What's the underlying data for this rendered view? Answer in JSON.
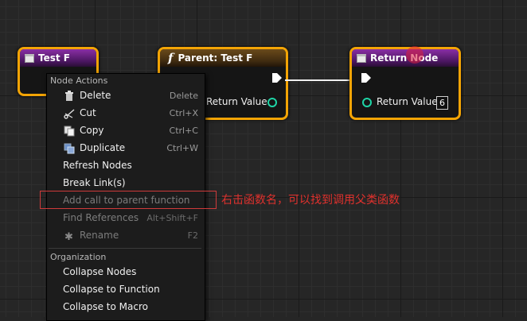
{
  "nodes": {
    "test_f": {
      "title": "Test F",
      "icon": "function-entry-icon"
    },
    "parent": {
      "title": "Parent: Test F",
      "icon": "function-f-icon",
      "pin_label": "Return Value"
    },
    "return": {
      "title": "Return Node",
      "icon": "function-return-icon",
      "pin_label": "Return Value",
      "value": "6"
    }
  },
  "colors": {
    "node_border": "#f3a405",
    "data_pin": "#1ed5a6",
    "annotation": "#e0312d",
    "highlight": "#cf3a3a"
  },
  "menu": {
    "node_actions_title": "Node Actions",
    "items": [
      {
        "label": "Delete",
        "shortcut": "Delete",
        "icon": "trash-icon",
        "enabled": true
      },
      {
        "label": "Cut",
        "shortcut": "Ctrl+X",
        "icon": "scissors-icon",
        "enabled": true
      },
      {
        "label": "Copy",
        "shortcut": "Ctrl+C",
        "icon": "copy-icon",
        "enabled": true
      },
      {
        "label": "Duplicate",
        "shortcut": "Ctrl+W",
        "icon": "duplicate-icon",
        "enabled": true
      },
      {
        "label": "Refresh Nodes",
        "shortcut": "",
        "enabled": true
      },
      {
        "label": "Break Link(s)",
        "shortcut": "",
        "enabled": true
      },
      {
        "label": "Add call to parent function",
        "shortcut": "",
        "enabled": false
      },
      {
        "label": "Find References",
        "shortcut": "Alt+Shift+F",
        "enabled": false
      },
      {
        "label": "Rename",
        "shortcut": "F2",
        "icon": "rename-icon",
        "enabled": false
      }
    ],
    "organization_title": "Organization",
    "org_items": [
      {
        "label": "Collapse Nodes"
      },
      {
        "label": "Collapse to Function"
      },
      {
        "label": "Collapse to Macro"
      }
    ]
  },
  "annotation": "右击函数名，可以找到调用父类函数"
}
